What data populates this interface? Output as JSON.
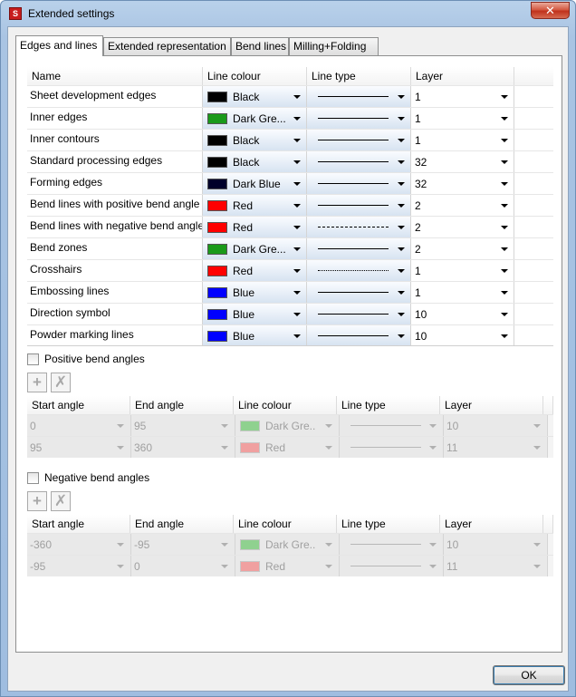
{
  "window": {
    "title": "Extended settings",
    "close_glyph": "✕",
    "app_icon_glyph": "S"
  },
  "tabs": [
    {
      "label": "Edges and lines",
      "active": true
    },
    {
      "label": "Extended representation",
      "active": false
    },
    {
      "label": "Bend lines",
      "active": false
    },
    {
      "label": "Milling+Folding",
      "active": false
    }
  ],
  "main_grid": {
    "headers": [
      "Name",
      "Line colour",
      "Line type",
      "Layer"
    ],
    "rows": [
      {
        "name": "Sheet development edges",
        "color_name": "Black",
        "color": "#000000",
        "line": "solid",
        "layer": "1"
      },
      {
        "name": "Inner edges",
        "color_name": "Dark Gre...",
        "color": "#1a9a1a",
        "line": "solid",
        "layer": "1"
      },
      {
        "name": "Inner contours",
        "color_name": "Black",
        "color": "#000000",
        "line": "solid",
        "layer": "1"
      },
      {
        "name": "Standard processing edges",
        "color_name": "Black",
        "color": "#000000",
        "line": "solid",
        "layer": "32"
      },
      {
        "name": "Forming edges",
        "color_name": "Dark Blue",
        "color": "#00002a",
        "line": "solid",
        "layer": "32"
      },
      {
        "name": "Bend lines with positive bend angle",
        "color_name": "Red",
        "color": "#ff0000",
        "line": "solid",
        "layer": "2"
      },
      {
        "name": "Bend lines with negative bend angle",
        "color_name": "Red",
        "color": "#ff0000",
        "line": "dashed",
        "layer": "2"
      },
      {
        "name": "Bend zones",
        "color_name": "Dark Gre...",
        "color": "#1a9a1a",
        "line": "solid",
        "layer": "2"
      },
      {
        "name": "Crosshairs",
        "color_name": "Red",
        "color": "#ff0000",
        "line": "dashdot",
        "layer": "1"
      },
      {
        "name": "Embossing lines",
        "color_name": "Blue",
        "color": "#0000ff",
        "line": "solid",
        "layer": "1"
      },
      {
        "name": "Direction symbol",
        "color_name": "Blue",
        "color": "#0000ff",
        "line": "solid",
        "layer": "10"
      },
      {
        "name": "Powder marking lines",
        "color_name": "Blue",
        "color": "#0000ff",
        "line": "solid",
        "layer": "10"
      }
    ]
  },
  "positive": {
    "label": "Positive bend angles",
    "checked": false,
    "add_glyph": "+",
    "delete_glyph": "✗",
    "headers": [
      "Start angle",
      "End angle",
      "Line colour",
      "Line type",
      "Layer"
    ],
    "rows": [
      {
        "start": "0",
        "end": "95",
        "color_name": "Dark Gre...",
        "color": "#8fd18f",
        "layer": "10"
      },
      {
        "start": "95",
        "end": "360",
        "color_name": "Red",
        "color": "#f0a0a0",
        "layer": "11"
      }
    ]
  },
  "negative": {
    "label": "Negative bend angles",
    "checked": false,
    "add_glyph": "+",
    "delete_glyph": "✗",
    "headers": [
      "Start angle",
      "End angle",
      "Line colour",
      "Line type",
      "Layer"
    ],
    "rows": [
      {
        "start": "-360",
        "end": "-95",
        "color_name": "Dark Gre...",
        "color": "#8fd18f",
        "layer": "10"
      },
      {
        "start": "-95",
        "end": "0",
        "color_name": "Red",
        "color": "#f0a0a0",
        "layer": "11"
      }
    ]
  },
  "ok_label": "OK"
}
